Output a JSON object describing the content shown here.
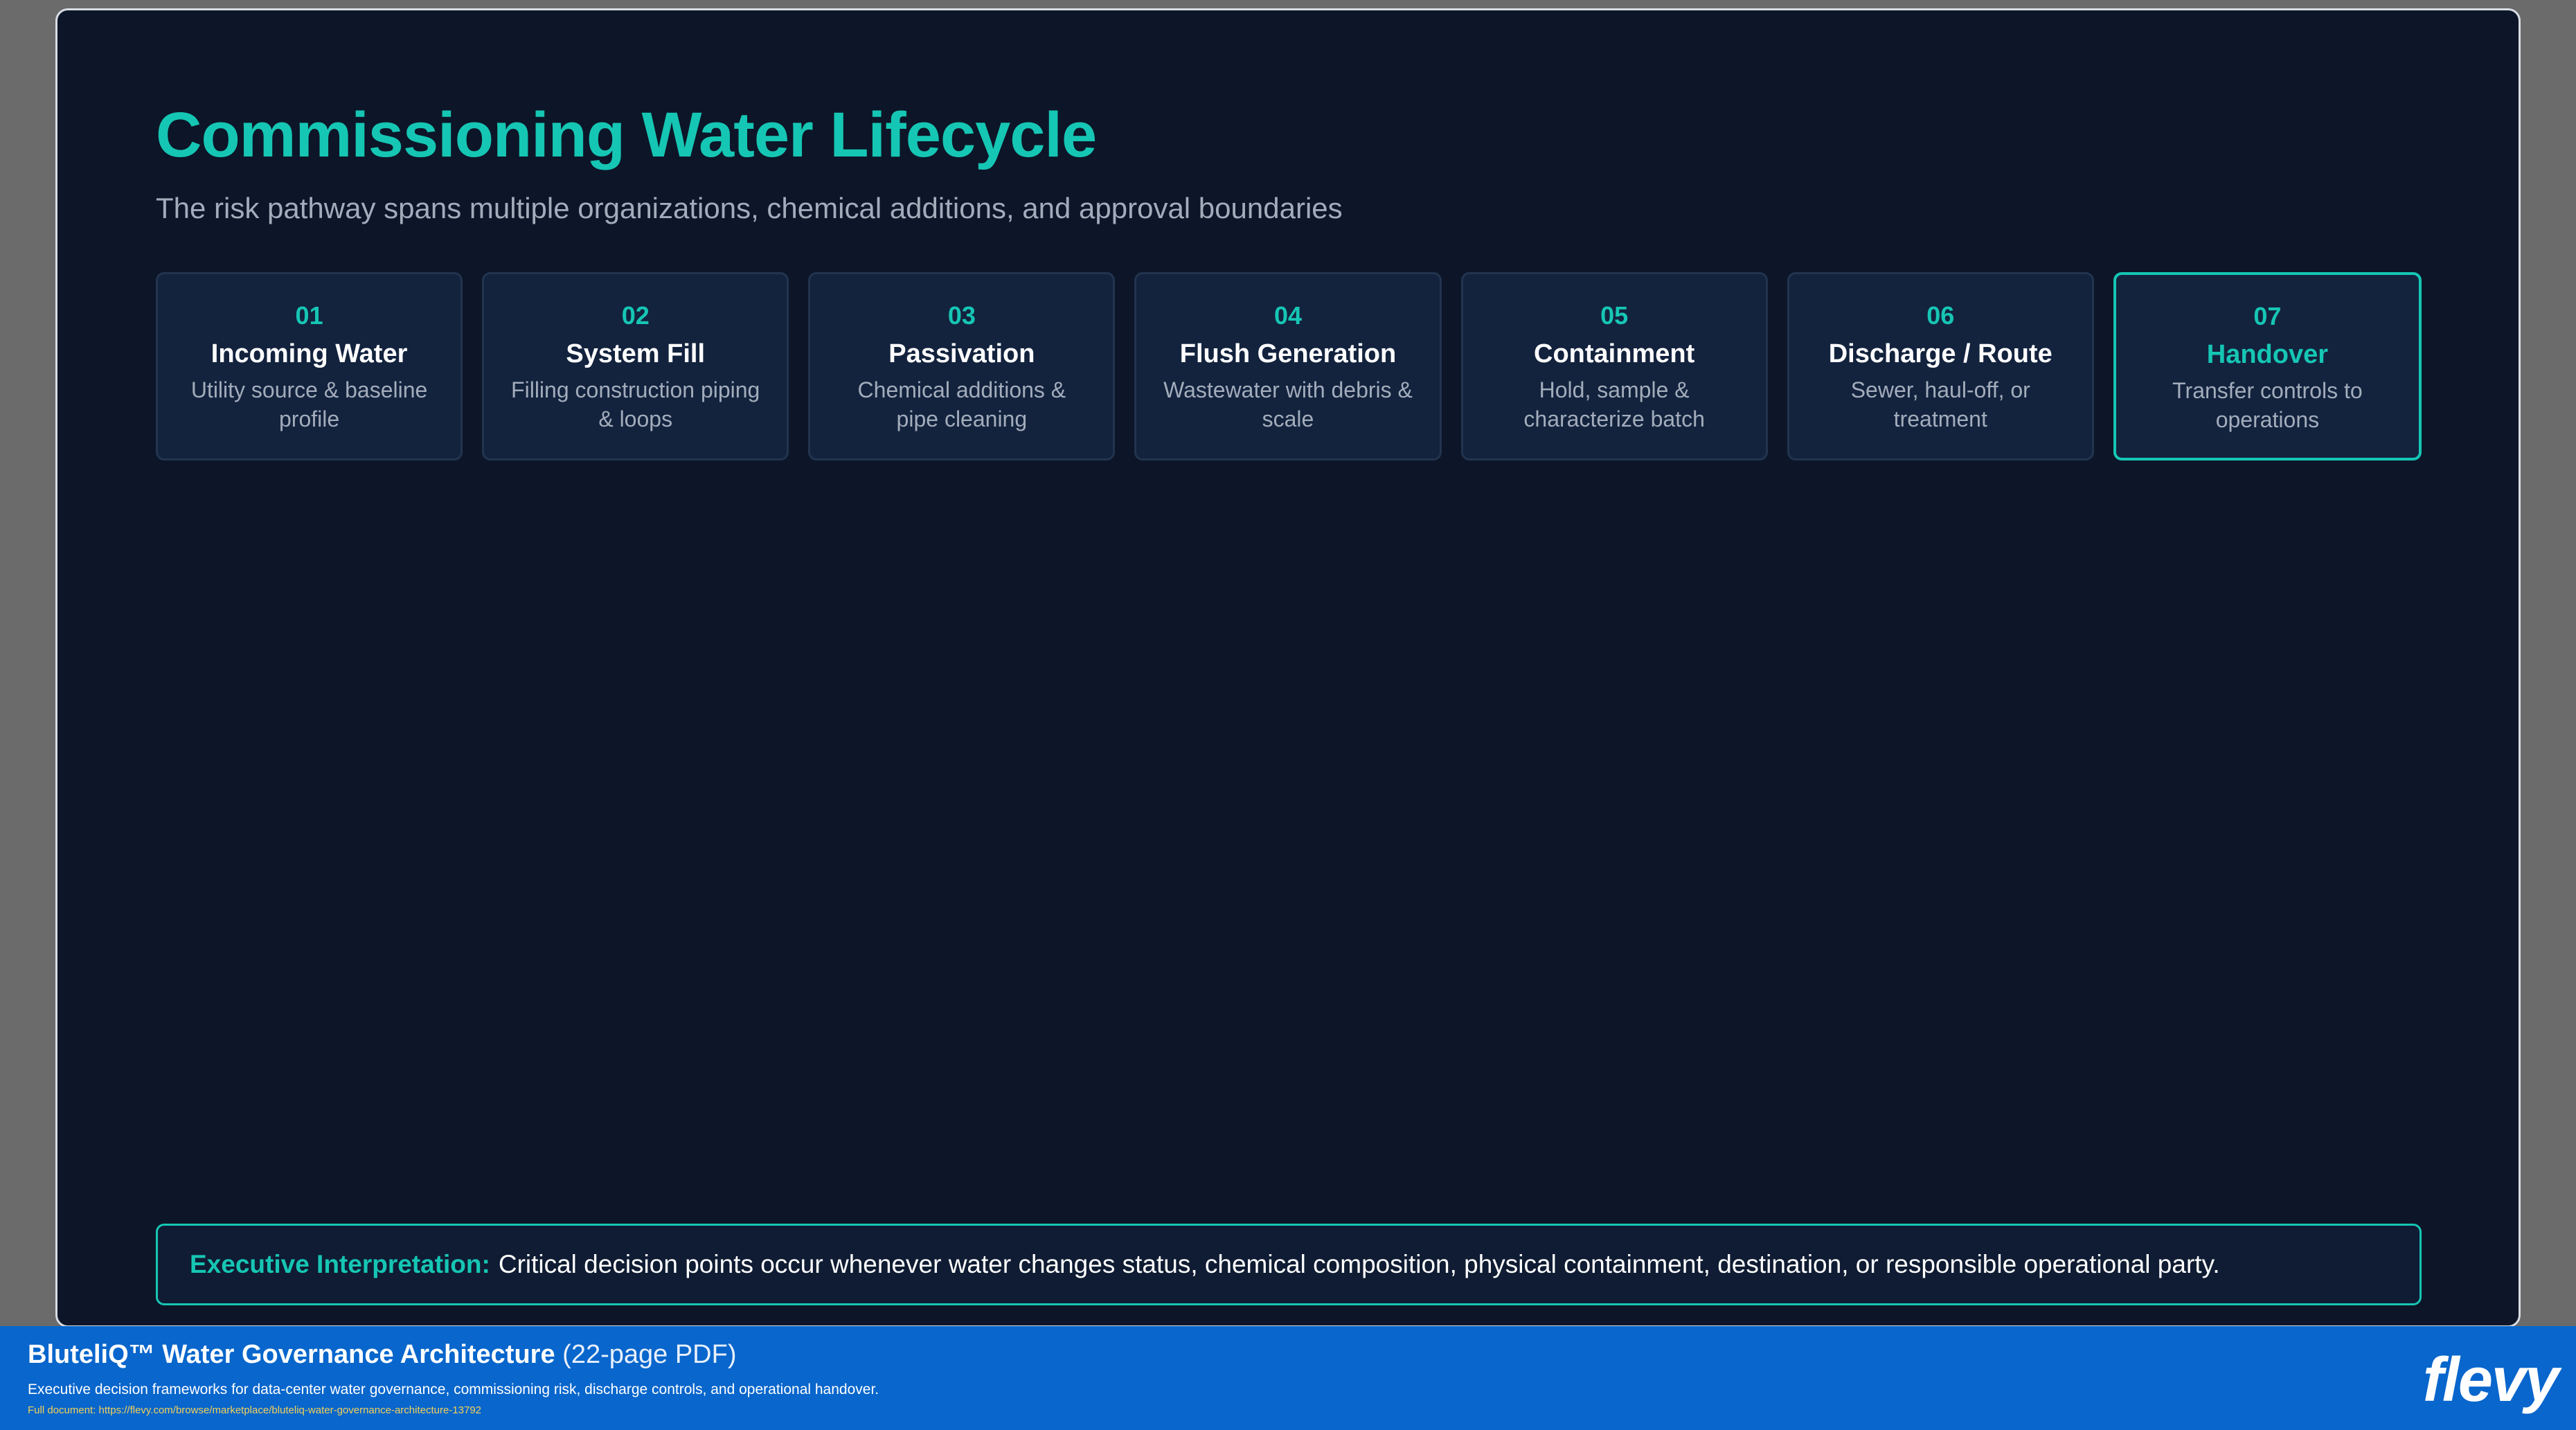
{
  "slide": {
    "title": "Commissioning Water Lifecycle",
    "subtitle": "The risk pathway spans multiple organizations, chemical additions, and approval boundaries"
  },
  "steps": [
    {
      "num": "01",
      "title": "Incoming Water",
      "desc": "Utility source & baseline profile"
    },
    {
      "num": "02",
      "title": "System Fill",
      "desc": "Filling construction piping & loops"
    },
    {
      "num": "03",
      "title": "Passivation",
      "desc": "Chemical additions & pipe cleaning"
    },
    {
      "num": "04",
      "title": "Flush Generation",
      "desc": "Wastewater with debris & scale"
    },
    {
      "num": "05",
      "title": "Containment",
      "desc": "Hold, sample & characterize batch"
    },
    {
      "num": "06",
      "title": "Discharge / Route",
      "desc": "Sewer, haul-off, or treatment"
    },
    {
      "num": "07",
      "title": "Handover",
      "desc": "Transfer controls to operations"
    }
  ],
  "callout": {
    "label": "Executive Interpretation:",
    "text": "Critical decision points occur whenever water changes status, chemical composition, physical containment, destination, or responsible operational party."
  },
  "footer": {
    "title": "BluteliQ™ Water Governance Architecture",
    "pages": "(22-page PDF)",
    "description": "Executive decision frameworks for data-center water governance, commissioning risk, discharge controls, and operational handover.",
    "link": "Full document: https://flevy.com/browse/marketplace/bluteliq-water-governance-architecture-13792",
    "logo": "flevy"
  },
  "colors": {
    "accent": "#16c6b4",
    "background": "#0c1628",
    "card": "#13233e",
    "footer": "#0866cc"
  }
}
